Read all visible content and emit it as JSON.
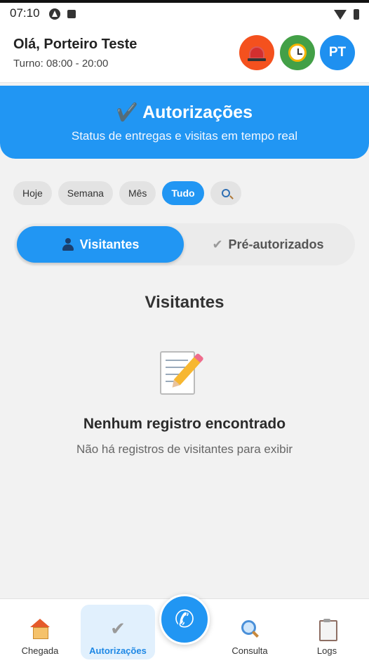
{
  "status_bar": {
    "time": "07:10"
  },
  "header": {
    "greeting": "Olá, Porteiro Teste",
    "shift": "Turno: 08:00 - 20:00",
    "avatar_initials": "PT"
  },
  "banner": {
    "title": "✔️ Autorizações",
    "subtitle": "Status de entregas e visitas em tempo real"
  },
  "filters": {
    "items": [
      "Hoje",
      "Semana",
      "Mês",
      "Tudo"
    ],
    "active": "Tudo"
  },
  "tabs": {
    "visitors": "Visitantes",
    "preauthorized": "Pré-autorizados",
    "active": "Visitantes"
  },
  "section_title": "Visitantes",
  "empty_state": {
    "title": "Nenhum registro encontrado",
    "message": "Não há registros de visitantes para exibir"
  },
  "bottom_nav": {
    "items": [
      "Chegada",
      "Autorizações",
      "Consulta",
      "Logs"
    ],
    "active": "Autorizações"
  },
  "colors": {
    "primary": "#2196f3",
    "alarm": "#f4511e",
    "timer": "#43a047",
    "background": "#f2f2f2"
  }
}
